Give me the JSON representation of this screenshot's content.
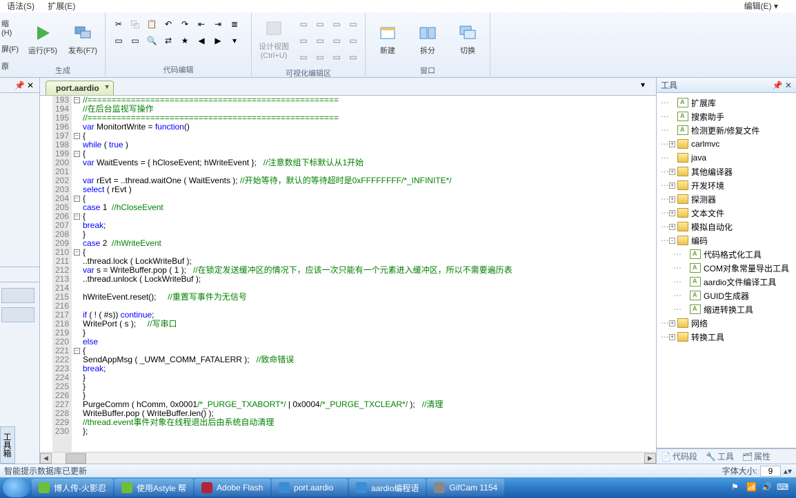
{
  "menu": {
    "syntax": "语法(S)",
    "extend": "扩展(E)",
    "edit": "编辑(E) ▾",
    "compress": "缩(H)",
    "screen": "屏(F)",
    "restore": "原"
  },
  "ribbon": {
    "gen_group": "生成",
    "code_group": "代码编辑",
    "vis_group": "可视化编辑区",
    "win_group": "窗口",
    "run": "运行(F5)",
    "publish": "发布(F7)",
    "design": "设计视图\n(Ctrl+U)",
    "new": "新建",
    "split": "拆分",
    "switch": "切换"
  },
  "tab": {
    "name": "port.aardio"
  },
  "tools_panel": {
    "title": "工具"
  },
  "bottom_tabs": {
    "code": "代码段",
    "tools": "工具",
    "props": "属性"
  },
  "toolbox_tab": "工具箱",
  "status": {
    "msg": "智能提示数据库已更新",
    "fontlabel": "字体大小:",
    "fontsize": "9"
  },
  "tree": [
    {
      "d": 0,
      "e": "",
      "t": "file",
      "label": "扩展库"
    },
    {
      "d": 0,
      "e": "",
      "t": "file",
      "label": "搜索助手"
    },
    {
      "d": 0,
      "e": "",
      "t": "file",
      "label": "检测更新/修复文件"
    },
    {
      "d": 0,
      "e": "+",
      "t": "folder",
      "label": "carlmvc"
    },
    {
      "d": 0,
      "e": "",
      "t": "folder",
      "label": "java"
    },
    {
      "d": 0,
      "e": "+",
      "t": "folder",
      "label": "其他编译器"
    },
    {
      "d": 0,
      "e": "+",
      "t": "folder",
      "label": "开发环境"
    },
    {
      "d": 0,
      "e": "+",
      "t": "folder",
      "label": "探测器"
    },
    {
      "d": 0,
      "e": "+",
      "t": "folder",
      "label": "文本文件"
    },
    {
      "d": 0,
      "e": "+",
      "t": "folder",
      "label": "模拟自动化"
    },
    {
      "d": 0,
      "e": "-",
      "t": "folder",
      "label": "编码"
    },
    {
      "d": 1,
      "e": "",
      "t": "file",
      "label": "代码格式化工具"
    },
    {
      "d": 1,
      "e": "",
      "t": "file",
      "label": "COM对象常量导出工具"
    },
    {
      "d": 1,
      "e": "",
      "t": "file",
      "label": "aardio文件编译工具"
    },
    {
      "d": 1,
      "e": "",
      "t": "file",
      "label": "GUID生成器"
    },
    {
      "d": 1,
      "e": "",
      "t": "file",
      "label": "缩进转换工具"
    },
    {
      "d": 0,
      "e": "+",
      "t": "folder",
      "label": "网络"
    },
    {
      "d": 0,
      "e": "+",
      "t": "folder",
      "label": "转换工具"
    }
  ],
  "code_start": 193,
  "code": [
    {
      "f": "-",
      "h": "//===================================================="
    },
    {
      "f": "|",
      "h": "//在后台监视写操作"
    },
    {
      "f": "|",
      "h": "//===================================================="
    },
    {
      "f": "|",
      "h": "<span class='kw'>var</span> MonitortWrite = <span class='kw'>function</span>()"
    },
    {
      "f": "-",
      "h": "{"
    },
    {
      "f": "|",
      "h": "<span class='kw'>while</span> ( <span class='kw'>true</span> )"
    },
    {
      "f": "-",
      "h": "{"
    },
    {
      "f": "|",
      "h": "<span class='kw'>var</span> WaitEvents = { hCloseEvent; hWriteEvent };   <span class='cm'>//注意数组下标默认从1开始</span>"
    },
    {
      "f": "|",
      "h": ""
    },
    {
      "f": "|",
      "h": "<span class='kw'>var</span> rEvt = ..thread.waitOne ( WaitEvents ); <span class='cm'>//开始等待，默认的等待超时是0xFFFFFFFF/*_INFINITE*/</span>"
    },
    {
      "f": "|",
      "h": "<span class='kw'>select</span> ( rEvt )"
    },
    {
      "f": "-",
      "h": "{"
    },
    {
      "f": "|",
      "h": "<span class='kw'>case</span> 1  <span class='cm'>//hCloseEvent</span>"
    },
    {
      "f": "-",
      "h": "{"
    },
    {
      "f": "|",
      "h": "<span class='kw'>break</span>;"
    },
    {
      "f": "|",
      "h": "}"
    },
    {
      "f": "|",
      "h": "<span class='kw'>case</span> 2  <span class='cm'>//hWriteEvent</span>"
    },
    {
      "f": "-",
      "h": "{"
    },
    {
      "f": "|",
      "h": "..thread.lock ( LockWriteBuf );"
    },
    {
      "f": "|",
      "h": "<span class='kw'>var</span> s = WriteBuffer.pop ( 1 );   <span class='cm'>//在锁定发送缓冲区的情况下，应该一次只能有一个元素进入缓冲区，所以不需要遍历表</span>"
    },
    {
      "f": "|",
      "h": "..thread.unlock ( LockWriteBuf );"
    },
    {
      "f": "|",
      "h": ""
    },
    {
      "f": "|",
      "h": "hWriteEvent.reset();     <span class='cm'>//重置写事件为无信号</span>"
    },
    {
      "f": "|",
      "h": ""
    },
    {
      "f": "|",
      "h": "<span class='kw'>if</span> ( ! ( #s)) <span class='kw'>continue</span>;"
    },
    {
      "f": "|",
      "h": "WritePort ( s );     <span class='cm'>//写串口</span>"
    },
    {
      "f": "|",
      "h": "}"
    },
    {
      "f": "|",
      "h": "<span class='kw'>else</span>"
    },
    {
      "f": "-",
      "h": "{"
    },
    {
      "f": "|",
      "h": "SendAppMsg ( _UWM_COMM_FATALERR );   <span class='cm'>//致命错误</span>"
    },
    {
      "f": "|",
      "h": "<span class='kw'>break</span>;"
    },
    {
      "f": "|",
      "h": "}"
    },
    {
      "f": "|",
      "h": "}"
    },
    {
      "f": "|",
      "h": "}"
    },
    {
      "f": "|",
      "h": "PurgeComm ( hComm, 0x0001<span class='cm'>/*_PURGE_TXABORT*/</span> | 0x0004<span class='cm'>/*_PURGE_TXCLEAR*/</span> );   <span class='cm'>//清理</span>"
    },
    {
      "f": "|",
      "h": "WriteBuffer.pop ( WriteBuffer.len() );"
    },
    {
      "f": "|",
      "h": "<span class='cm'>//thread.event事件对象在线程退出后由系统自动清理</span>"
    },
    {
      "f": "|",
      "h": "};"
    }
  ],
  "taskbar": {
    "items": [
      {
        "label": "博人传-火影忍",
        "color": "#6dbf3a"
      },
      {
        "label": "使用Astyle 帮",
        "color": "#6dbf3a"
      },
      {
        "label": "Adobe Flash",
        "color": "#b2243c"
      },
      {
        "label": "port.aardio",
        "color": "#3b8dd6"
      },
      {
        "label": "aardio编程语",
        "color": "#3b8dd6"
      },
      {
        "label": "GifCam 1154",
        "color": "#888"
      }
    ]
  }
}
